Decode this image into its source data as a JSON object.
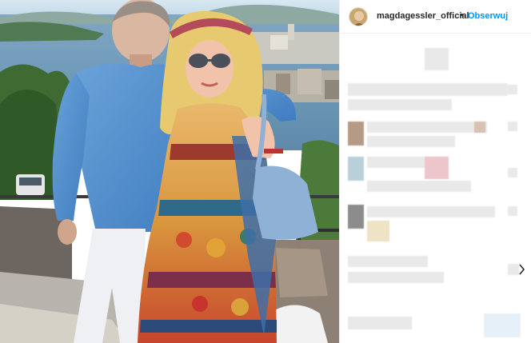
{
  "post": {
    "username": "magdagessler_official",
    "separator": "•",
    "follow_label": "Obserwuj"
  },
  "colors": {
    "accent": "#0095f6",
    "text": "#262626",
    "blurred": "#e9e9e9"
  },
  "icons": [
    "avatar",
    "more-icon"
  ]
}
